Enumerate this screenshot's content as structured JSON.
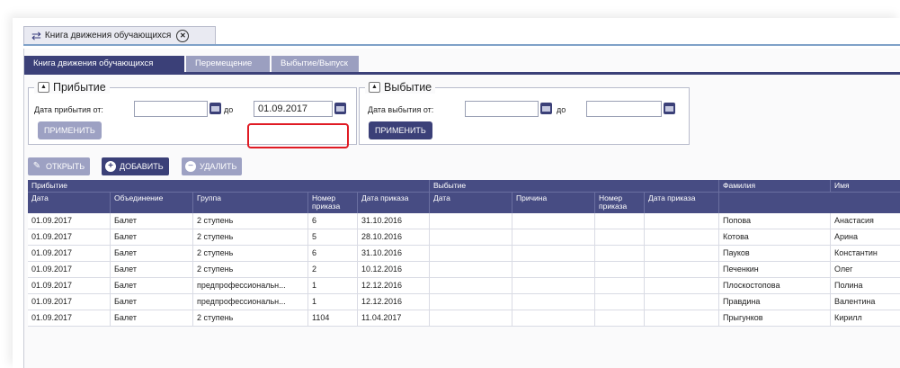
{
  "window": {
    "title": "Книга движения обучающихся"
  },
  "tabs": [
    {
      "label": "Книга движения обучающихся",
      "active": true
    },
    {
      "label": "Перемещение",
      "active": false
    },
    {
      "label": "Выбытие/Выпуск",
      "active": false
    }
  ],
  "arrival": {
    "legend": "Прибытие",
    "date_from_label": "Дата прибытия от:",
    "date_from_value": "",
    "to_label": "до",
    "date_to_value": "01.09.2017",
    "apply_label": "ПРИМЕНИТЬ"
  },
  "departure": {
    "legend": "Выбытие",
    "date_from_label": "Дата выбытия от:",
    "date_from_value": "",
    "to_label": "до",
    "date_to_value": "",
    "apply_label": "ПРИМЕНИТЬ"
  },
  "toolbar": {
    "open_label": "ОТКРЫТЬ",
    "add_label": "ДОБАВИТЬ",
    "delete_label": "УДАЛИТЬ"
  },
  "table": {
    "groups": {
      "arrival": "Прибытие",
      "departure": "Выбытие",
      "surname": "Фамилия",
      "name": "Имя"
    },
    "columns": [
      "Дата",
      "Объединение",
      "Группа",
      "Номер приказа",
      "Дата приказа",
      "Дата",
      "Причина",
      "Номер приказа",
      "Дата приказа"
    ],
    "rows": [
      [
        "01.09.2017",
        "Балет",
        "2 ступень",
        "6",
        "31.10.2016",
        "",
        "",
        "",
        "",
        "Попова",
        "Анастасия"
      ],
      [
        "01.09.2017",
        "Балет",
        "2 ступень",
        "5",
        "28.10.2016",
        "",
        "",
        "",
        "",
        "Котова",
        "Арина"
      ],
      [
        "01.09.2017",
        "Балет",
        "2 ступень",
        "6",
        "31.10.2016",
        "",
        "",
        "",
        "",
        "Пауков",
        "Константин"
      ],
      [
        "01.09.2017",
        "Балет",
        "2 ступень",
        "2",
        "10.12.2016",
        "",
        "",
        "",
        "",
        "Печенкин",
        "Олег"
      ],
      [
        "01.09.2017",
        "Балет",
        "предпрофессиональн...",
        "1",
        "12.12.2016",
        "",
        "",
        "",
        "",
        "Плоскостопова",
        "Полина"
      ],
      [
        "01.09.2017",
        "Балет",
        "предпрофессиональн...",
        "1",
        "12.12.2016",
        "",
        "",
        "",
        "",
        "Правдина",
        "Валентина"
      ],
      [
        "01.09.2017",
        "Балет",
        "2 ступень",
        "1104",
        "11.04.2017",
        "",
        "",
        "",
        "",
        "Прыгунков",
        "Кирилл"
      ]
    ]
  },
  "colors": {
    "primary": "#3b4078",
    "inactive": "#9da1c3",
    "highlight": "#e01b24"
  }
}
